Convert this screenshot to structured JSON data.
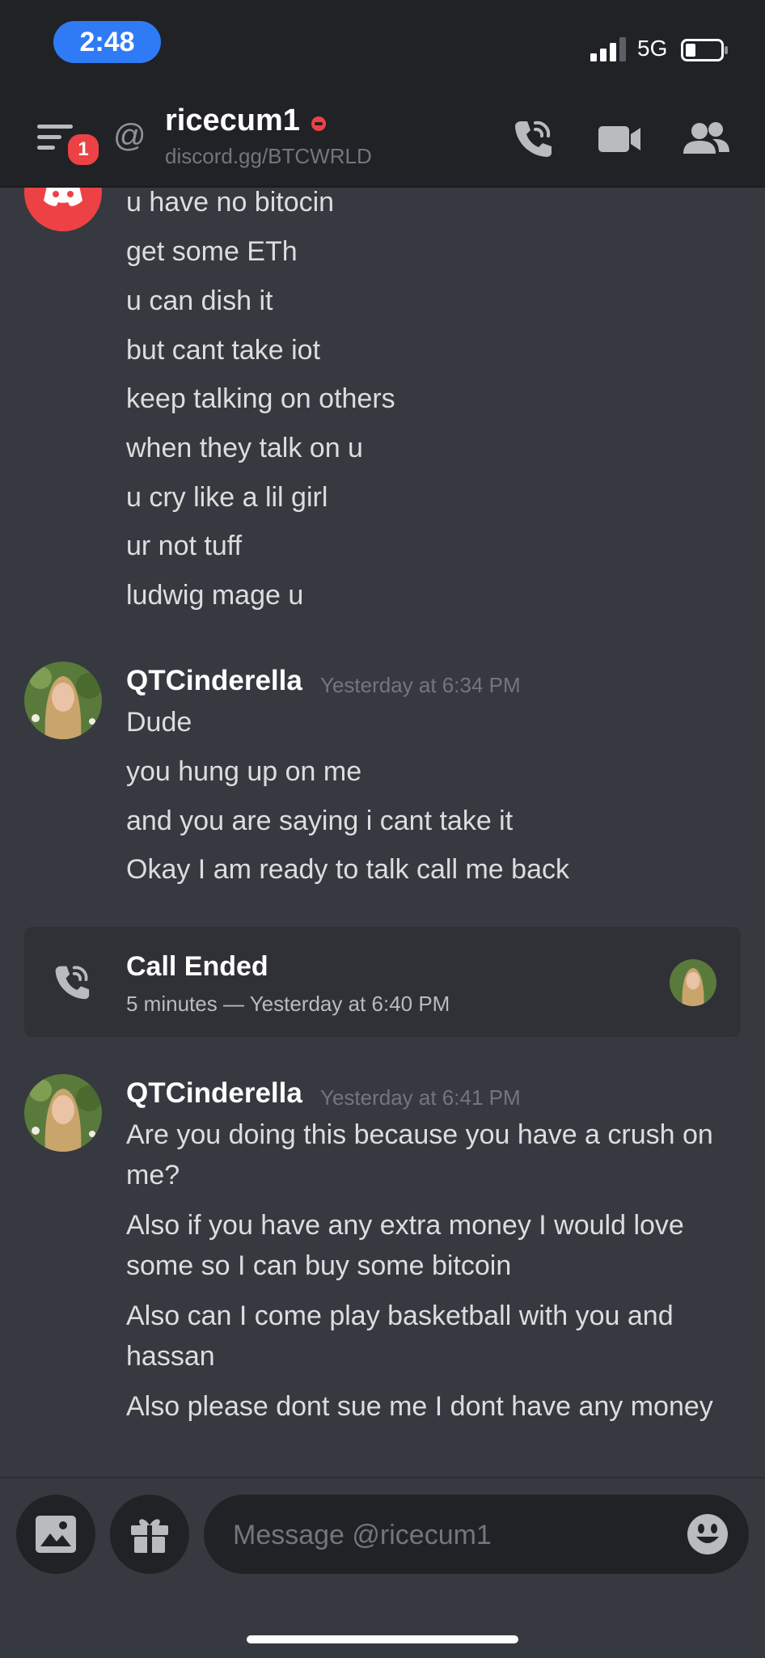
{
  "status_bar": {
    "time": "2:48",
    "network": "5G"
  },
  "header": {
    "menu_badge": "1",
    "at_symbol": "@",
    "channel_name": "ricecum1",
    "channel_subtitle": "discord.gg/BTCWRLD",
    "icons": [
      "phone-icon",
      "video-icon",
      "members-icon"
    ]
  },
  "messages": {
    "group1": {
      "lines": [
        "u have no bitocin",
        "get some ETh",
        "u can dish it",
        "but cant take iot",
        "keep talking on others",
        "when they talk on u",
        "u cry like a lil girl",
        "ur not tuff",
        "ludwig mage u"
      ]
    },
    "group2": {
      "author": "QTCinderella",
      "timestamp": "Yesterday at 6:34 PM",
      "lines": [
        "Dude",
        "you hung up on me",
        "and you are saying i cant take it",
        "Okay I am ready to talk call me back"
      ]
    },
    "call": {
      "title": "Call Ended",
      "detail": "5 minutes — Yesterday at 6:40 PM"
    },
    "group3": {
      "author": "QTCinderella",
      "timestamp": "Yesterday at 6:41 PM",
      "lines": [
        "Are you doing this because you have a crush on me?",
        "Also if you have any extra money I would love some so I can buy some bitcoin",
        "Also can I come play basketball with you and hassan",
        "Also please dont sue me I dont have any money"
      ]
    }
  },
  "composer": {
    "placeholder": "Message @ricecum1"
  },
  "colors": {
    "background": "#36393f",
    "header": "#202225",
    "accent_red": "#ed4245",
    "time_pill": "#2f7bf5"
  }
}
